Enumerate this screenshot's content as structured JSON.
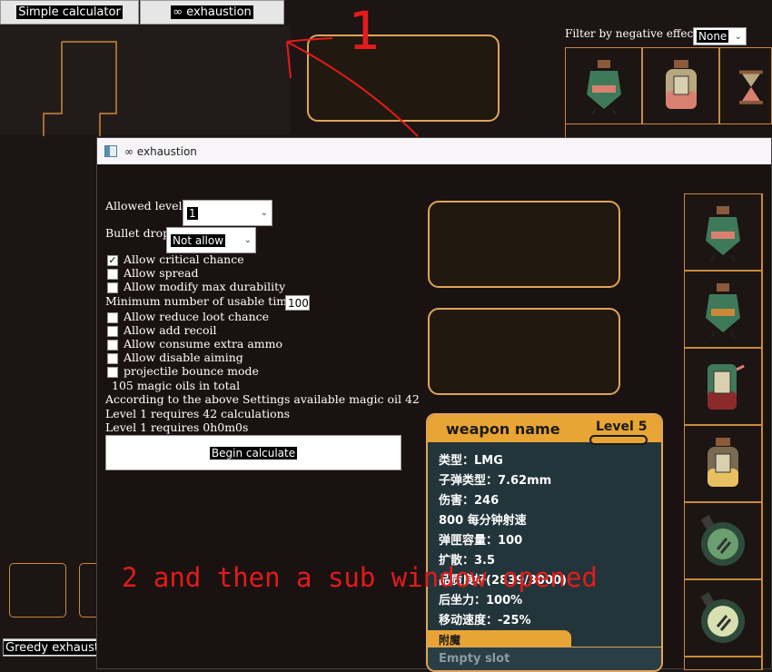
{
  "top_tabs": {
    "simple": "Simple calculator",
    "exhaustion": "∞ exhaustion"
  },
  "bottom_left_button": "Greedy exhaustiv",
  "filter": {
    "label": "Filter by negative effects",
    "value": "None"
  },
  "annotations": {
    "step1": "1",
    "step2": "2 and then a sub window opened"
  },
  "subwindow": {
    "title": "∞ exhaustion",
    "allowed_levels_label": "Allowed levels:",
    "allowed_levels_value": "1",
    "bullet_drop_label": "Bullet drop:",
    "bullet_drop_value": "Not allow",
    "checkboxes": [
      {
        "label": "Allow critical chance",
        "checked": true
      },
      {
        "label": "Allow spread",
        "checked": false
      },
      {
        "label": "Allow modify max durability",
        "checked": false
      }
    ],
    "min_usable_label": "Minimum number of usable times:",
    "min_usable_value": "100",
    "checkboxes2": [
      {
        "label": "Allow reduce loot chance",
        "checked": false
      },
      {
        "label": "Allow add recoil",
        "checked": false
      },
      {
        "label": "Allow consume extra ammo",
        "checked": false
      },
      {
        "label": "Allow disable aiming",
        "checked": false
      },
      {
        "label": "projectile bounce mode",
        "checked": false
      }
    ],
    "info_lines": [
      "105 magic oils in total",
      "According to the above Settings available magic oil 42",
      "Level 1 requires 42 calculations",
      "Level 1 requires 0h0m0s"
    ],
    "begin_button": "Begin calculate"
  },
  "weapon_panel": {
    "name": "weapon name",
    "level": "Level 5",
    "stats": [
      "类型：LMG",
      "子弹类型：7.62mm",
      "伤害：246",
      "800 每分钟射速",
      "弹匣容量：100",
      "扩散：3.5",
      "品质良好(2839/3000)",
      "后坐力：100%",
      "移动速度：-25%"
    ],
    "enchant_label": "附魔",
    "empty_slot": "Empty slot"
  },
  "colors": {
    "accent": "#e0a45a",
    "annotation_red": "#e31b1b",
    "panel_bg": "#22353a",
    "header_orange": "#e8a435"
  }
}
